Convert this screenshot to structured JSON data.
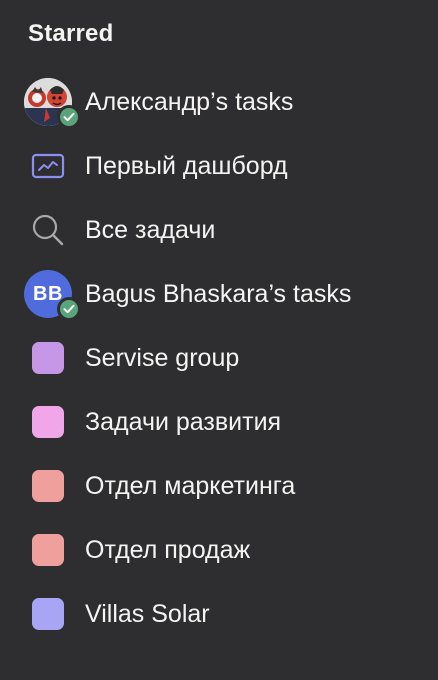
{
  "sidebar": {
    "section_title": "Starred",
    "items": [
      {
        "label": "Александр’s tasks",
        "icon": "user-avatar-photo",
        "badge": "check-icon"
      },
      {
        "label": "Первый дашборд",
        "icon": "dashboard-icon"
      },
      {
        "label": "Все задачи",
        "icon": "search-icon"
      },
      {
        "label": "Bagus Bhaskara’s tasks",
        "icon": "user-avatar-initials",
        "initials": "BB",
        "badge": "check-icon"
      },
      {
        "label": "Servise group",
        "icon": "project-color-square",
        "color": "#c597e6"
      },
      {
        "label": "Задачи развития",
        "icon": "project-color-square",
        "color": "#f0a6e8"
      },
      {
        "label": "Отдел маркетинга",
        "icon": "project-color-square",
        "color": "#f0a09c"
      },
      {
        "label": "Отдел продаж",
        "icon": "project-color-square",
        "color": "#f0a09c"
      },
      {
        "label": "Villas Solar",
        "icon": "project-color-square",
        "color": "#a9a5f5"
      }
    ]
  },
  "colors": {
    "background": "#2e2e30",
    "text": "#f5f4f3",
    "check_badge": "#5aa47b",
    "initials_avatar": "#4f6bdc",
    "dashboard_icon": "#8b8ff0",
    "search_icon": "#a8a8a8"
  }
}
